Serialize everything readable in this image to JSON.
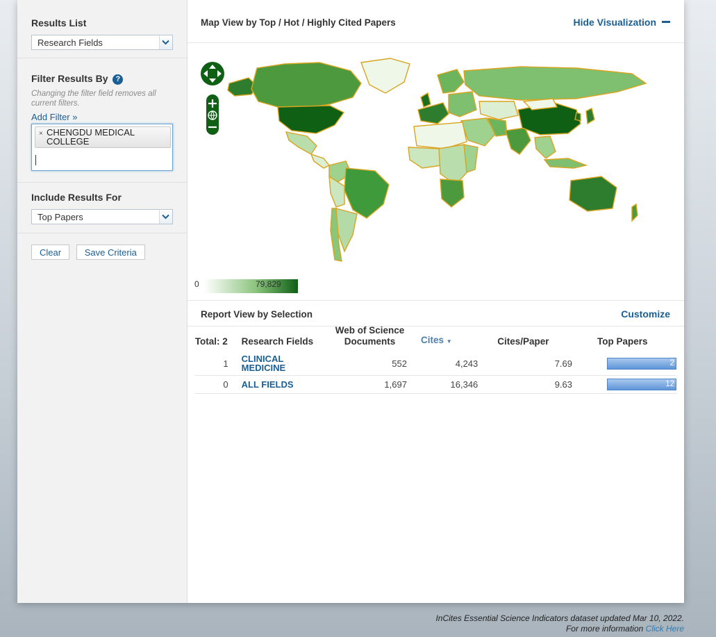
{
  "sidebar": {
    "results_list": {
      "title": "Results List",
      "selected": "Research Fields"
    },
    "filter": {
      "title": "Filter Results By",
      "help": "?",
      "hint": "Changing the filter field removes all current filters.",
      "add_filter": "Add Filter »",
      "chip_remove": "×",
      "chip_label": "CHENGDU MEDICAL COLLEGE"
    },
    "include": {
      "title": "Include Results For",
      "selected": "Top Papers"
    },
    "clear_label": "Clear",
    "save_label": "Save Criteria"
  },
  "map": {
    "title": "Map View by Top / Hot / Highly Cited Papers",
    "hide_label": "Hide Visualization",
    "legend_min": "0",
    "legend_max": "79,829",
    "colors": {
      "light": "#eef7e8",
      "mid": "#7ec06f",
      "dark": "#0f5f14",
      "border": "#d9a420"
    }
  },
  "report": {
    "title": "Report View by Selection",
    "customize": "Customize",
    "headers": {
      "total": "Total: 2",
      "field": "Research Fields",
      "docs": "Web of Science Documents",
      "cites": "Cites",
      "cites_per_paper": "Cites/Paper",
      "top_papers": "Top Papers"
    },
    "rows": [
      {
        "rank": "1",
        "field": "CLINICAL MEDICINE",
        "docs": "552",
        "cites": "4,243",
        "cpp": "7.69",
        "top_papers": "2"
      },
      {
        "rank": "0",
        "field": "ALL FIELDS",
        "docs": "1,697",
        "cites": "16,346",
        "cpp": "9.63",
        "top_papers": "12"
      }
    ]
  },
  "footer": {
    "line1": "InCites Essential Science Indicators dataset updated Mar 10, 2022.",
    "line2": "For more information",
    "link": "Click Here"
  }
}
